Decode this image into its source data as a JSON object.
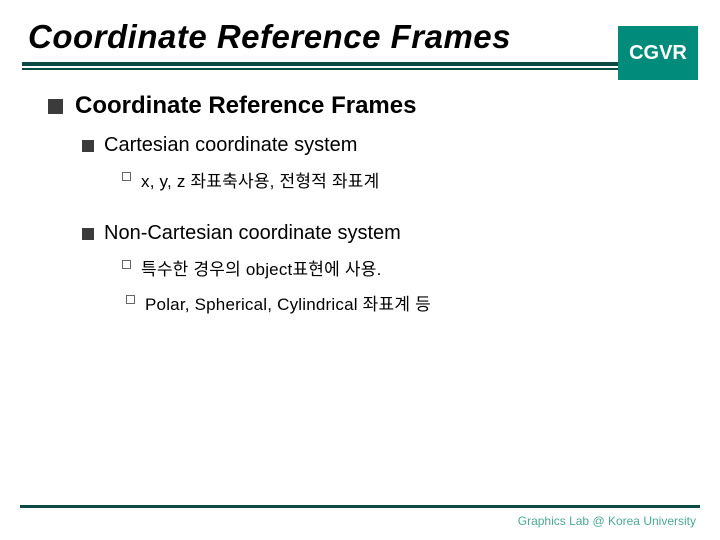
{
  "header": {
    "title": "Coordinate Reference Frames",
    "badge": "CGVR"
  },
  "content": {
    "l1": "Coordinate Reference Frames",
    "l2a": "Cartesian coordinate system",
    "l2a_sub1": "x, y, z 좌표축사용, 전형적 좌표계",
    "l2b": "Non-Cartesian coordinate system",
    "l2b_sub1": "특수한 경우의 object표현에 사용.",
    "l2b_sub2": "Polar, Spherical, Cylindrical 좌표계 등"
  },
  "footer": {
    "text": "Graphics Lab @ Korea University"
  }
}
